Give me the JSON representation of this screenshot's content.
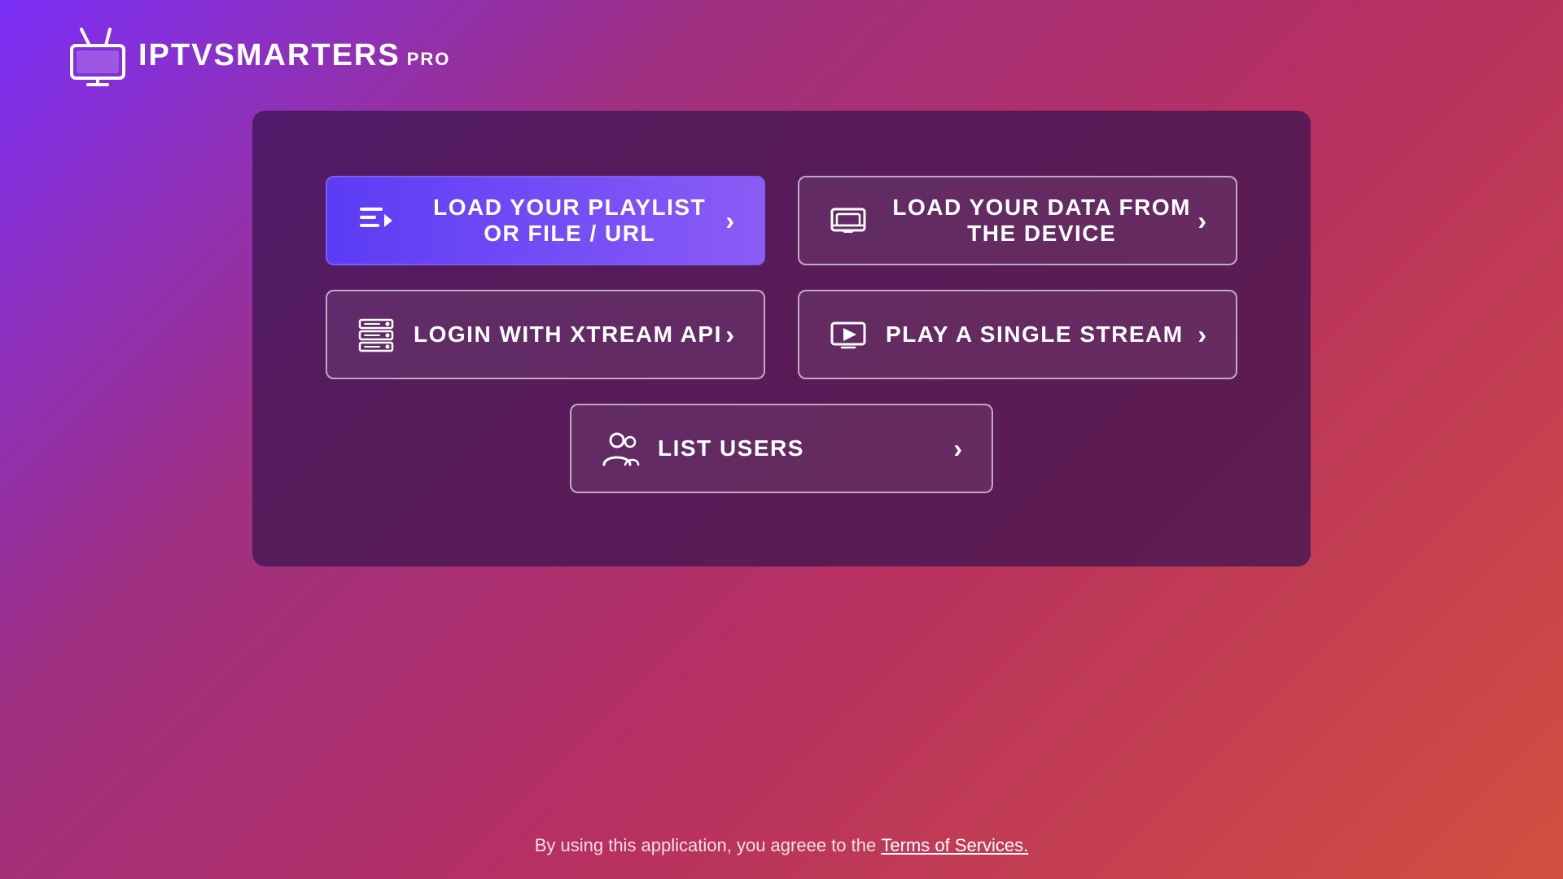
{
  "app": {
    "logo_iptv": "IPTV",
    "logo_smarters": "SMARTERS",
    "logo_pro": "PRO"
  },
  "buttons": {
    "playlist": {
      "label": "LOAD YOUR PLAYLIST OR FILE / URL",
      "highlighted": true
    },
    "device": {
      "label": "LOAD YOUR DATA FROM THE DEVICE",
      "highlighted": false
    },
    "xtream": {
      "label": "LOGIN WITH XTREAM API",
      "highlighted": false
    },
    "stream": {
      "label": "PLAY A SINGLE STREAM",
      "highlighted": false
    },
    "list_users": {
      "label": "LIST USERS",
      "highlighted": false
    }
  },
  "footer": {
    "text": "By using this application, you agreee to the ",
    "link_text": "Terms of Services."
  }
}
